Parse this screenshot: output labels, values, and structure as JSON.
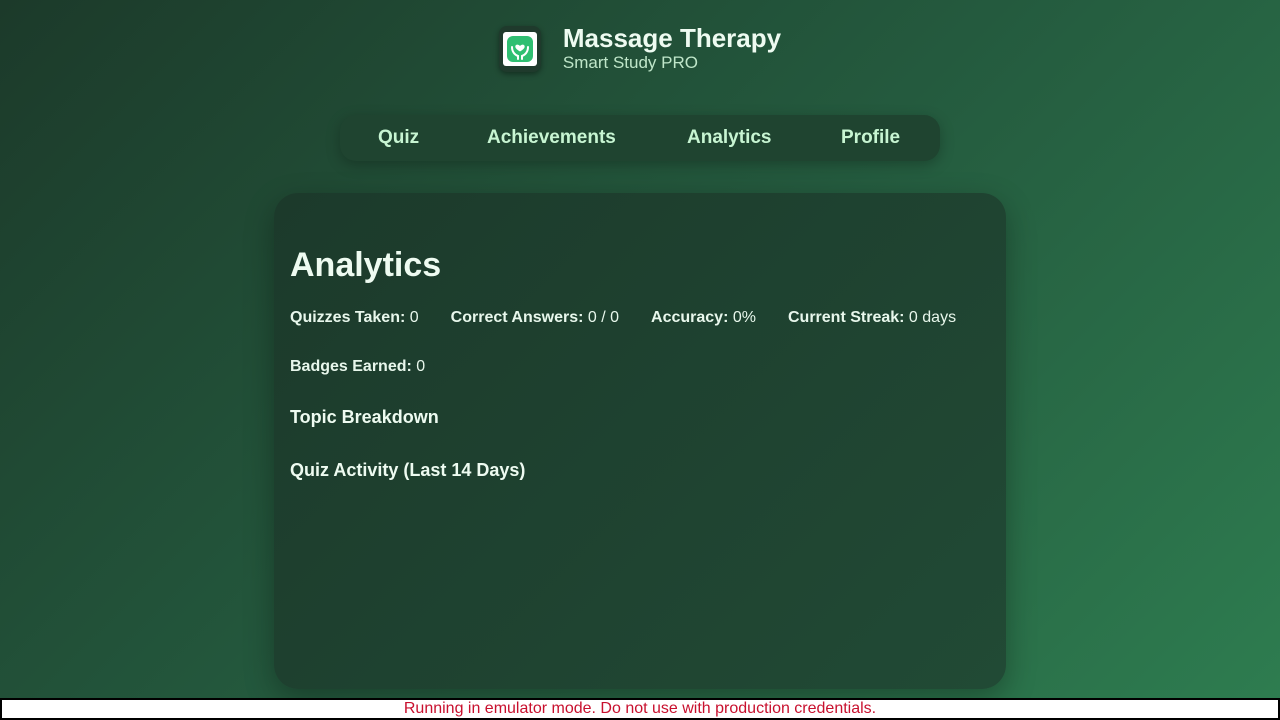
{
  "app": {
    "title": "Massage Therapy",
    "subtitle": "Smart Study PRO",
    "icon": "hands-heart-icon"
  },
  "nav": {
    "items": [
      {
        "label": "Quiz"
      },
      {
        "label": "Achievements"
      },
      {
        "label": "Analytics"
      },
      {
        "label": "Profile"
      }
    ]
  },
  "analytics": {
    "title": "Analytics",
    "stats": {
      "quizzes_label": "Quizzes Taken:",
      "quizzes_value": "0",
      "correct_label": "Correct Answers:",
      "correct_value": "0 / 0",
      "accuracy_label": "Accuracy:",
      "accuracy_value": "0%",
      "streak_label": "Current Streak:",
      "streak_value": "0 days",
      "badges_label": "Badges Earned:",
      "badges_value": "0"
    },
    "topic_breakdown_title": "Topic Breakdown",
    "activity_title": "Quiz Activity (Last 14 Days)"
  },
  "footer": {
    "message": "Running in emulator mode. Do not use with production credentials."
  },
  "colors": {
    "accent": "#c7f5d2",
    "icon_green": "#2fbf71",
    "warning_text": "#c8102e"
  }
}
